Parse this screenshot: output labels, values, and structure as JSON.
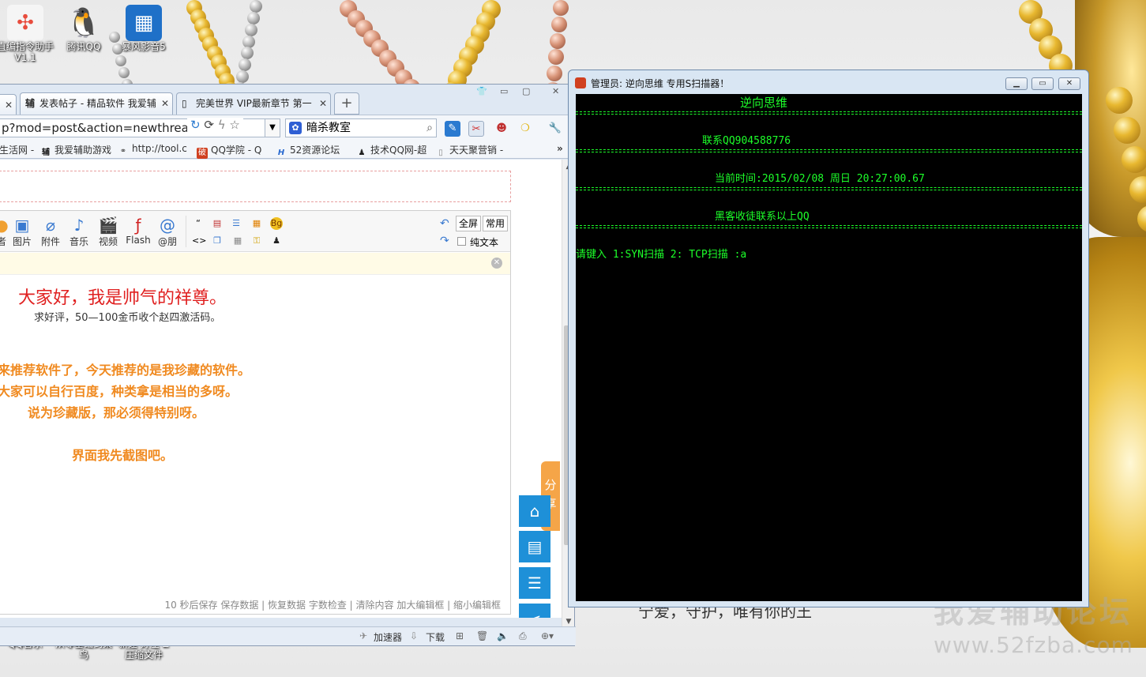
{
  "desktop": {
    "icons": [
      {
        "label": "直编指令助手",
        "label2": "V1.1",
        "icon": "pinwheel-icon",
        "color": "#e84c3d"
      },
      {
        "label": "腾讯QQ",
        "icon": "qq-penguin-icon",
        "color": "#222222"
      },
      {
        "label": "暴风影音5",
        "icon": "film-icon",
        "color": "#1f70c8"
      }
    ],
    "bottom_icons": [
      {
        "label": "QQ音乐"
      },
      {
        "label": "从零基础到菜",
        "label2": "鸟"
      },
      {
        "label": "新建 好压 Z",
        "label2": "压缩文件"
      }
    ],
    "watermark_cn": "我爱辅助论坛",
    "watermark_url": "www.52fzba.com",
    "bg_caption": "宁爱，守护，唯有你的王"
  },
  "browser": {
    "tabs": [
      {
        "label": "发表帖子 - 精品软件 我爱辅",
        "icon": "fu-icon"
      },
      {
        "label": "完美世界 VIP最新章节 第一",
        "icon": "page-icon"
      }
    ],
    "address": "p?mod=post&action=newthread",
    "search_engine": "暗杀教室",
    "favorites": [
      {
        "label": "生活网 -",
        "icon": "none"
      },
      {
        "label": "我爱辅助游戏",
        "icon": "fu-icon"
      },
      {
        "label": "http://tool.c",
        "icon": "link-icon"
      },
      {
        "label": "QQ学院 - Q",
        "icon": "po-icon"
      },
      {
        "label": "52资源论坛",
        "icon": "h-icon"
      },
      {
        "label": "技术QQ网-超",
        "icon": "qq-icon"
      },
      {
        "label": "天天聚营销 -",
        "icon": "page-icon"
      }
    ],
    "editor": {
      "toolbar": [
        {
          "label": "图片",
          "icon": "image-icon"
        },
        {
          "label": "附件",
          "icon": "paperclip-icon"
        },
        {
          "label": "音乐",
          "icon": "music-icon"
        },
        {
          "label": "视频",
          "icon": "video-icon"
        },
        {
          "label": "Flash",
          "icon": "flash-icon"
        },
        {
          "label": "@朋",
          "icon": "at-icon"
        }
      ],
      "fullscreen": "全屏",
      "common": "常用",
      "plaintext": "纯文本",
      "content": {
        "line1": "大家好，我是帅气的祥尊。",
        "line2": "求好评，50—100金币收个赵四激活码。",
        "line3": "来推荐软件了，今天推荐的是我珍藏的软件。",
        "line4": "大家可以自行百度，种类拿是相当的多呀。",
        "line5": "说为珍藏版，那必须得特别呀。",
        "line6": "界面我先截图吧。"
      },
      "footer": "10 秒后保存 保存数据 | 恢复数据    字数检查 | 清除内容    加大编辑框 | 缩小编辑框"
    },
    "share_label": "分享",
    "status": {
      "accelerator": "加速器",
      "download": "下载"
    }
  },
  "console": {
    "title": "管理员:  逆向思维 专用S扫描器！",
    "lines": [
      "逆向思维",
      "联系QQ904588776",
      "当前时间:2015/02/08 周日  20:27:00.67",
      "黑客收徒联系以上QQ",
      "请键入 1:SYN扫描 2: TCP扫描  :a"
    ],
    "text_color": "#1dff2a"
  }
}
